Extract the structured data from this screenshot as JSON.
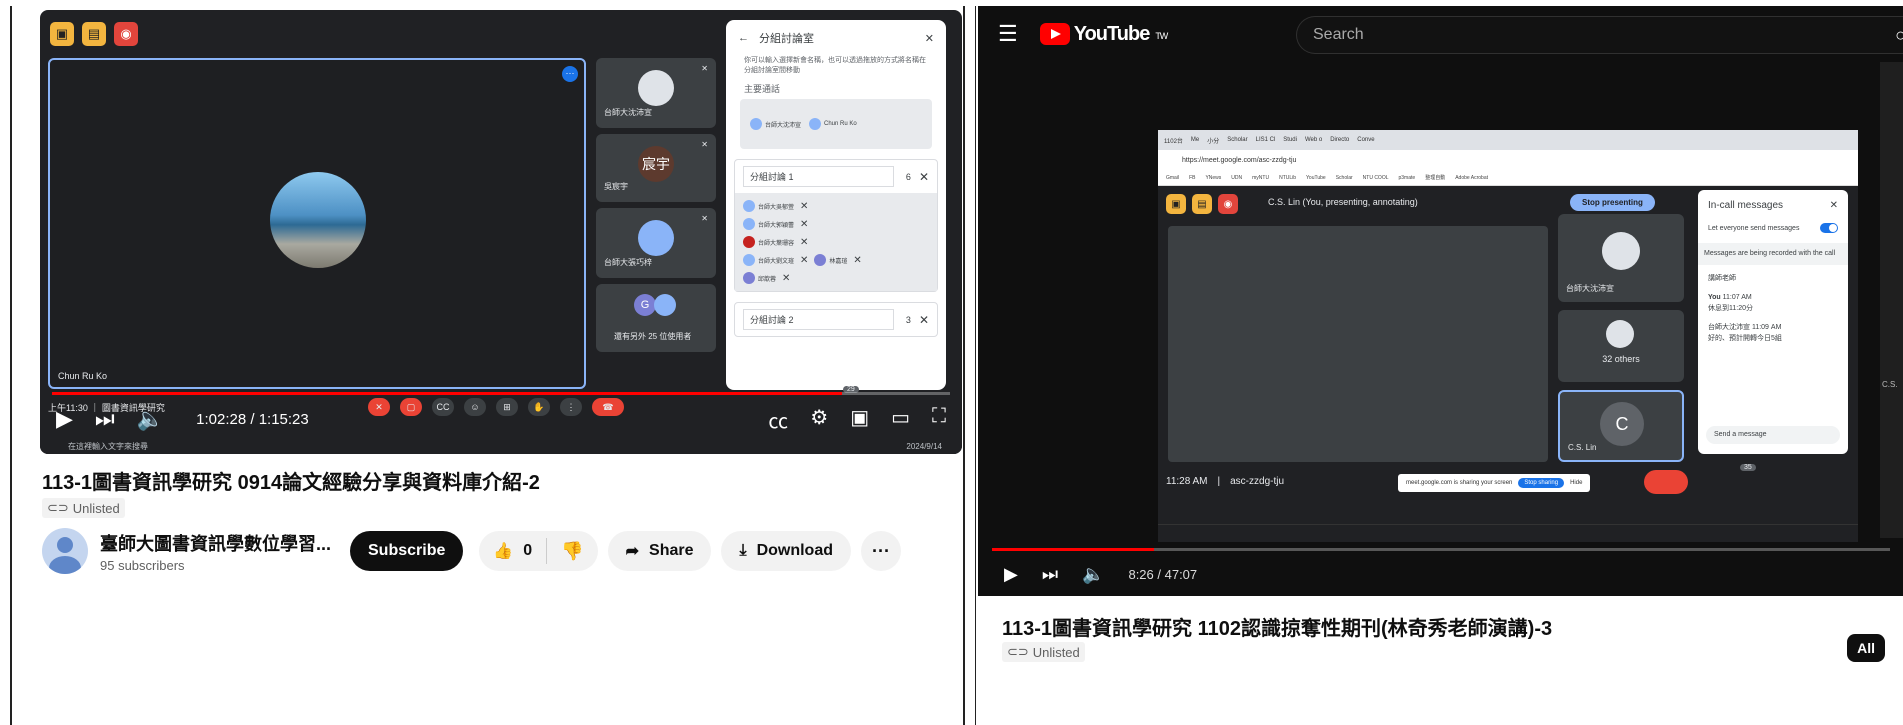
{
  "left": {
    "meet": {
      "main_tile_name": "Chun Ru Ko",
      "tiles": [
        {
          "name": "台師大沈沛宣",
          "avatar_text": ""
        },
        {
          "name": "吳宸宇",
          "avatar_text": "宸宇"
        },
        {
          "name": "台師大張巧梓",
          "avatar_text": ""
        },
        {
          "name": "還有另外 25 位使用者",
          "avatar_text": "G"
        }
      ],
      "breakout": {
        "title": "分組討論室",
        "desc": "你可以輸入選擇新會名稱，也可以透過拖放的方式將名稱在分組討論室間移動",
        "main_section": "主要通話",
        "main_members": [
          "台師大沈沛宣",
          "Chun Ru Ko"
        ],
        "groups": [
          {
            "name": "分組討論 1",
            "count": "6",
            "members": [
              "台師大吳郁萱",
              "台師大郭穎蕾",
              "台師大葉珊容",
              "台師大劉文瑄",
              "林嘉瑄",
              "邱歆蓉"
            ]
          },
          {
            "name": "分組討論 2",
            "count": "3",
            "members": []
          }
        ]
      },
      "bar_time": "上午11:30 ｜ 圖書資訊學研究",
      "participants_badge": "29",
      "taskbar_search": "在這裡輸入文字來搜尋",
      "taskbar_date": "2024/9/14"
    },
    "player": {
      "time": "1:02:28 / 1:15:23",
      "progress": 0.88
    },
    "video_title": "113-1圖書資訊學研究 0914論文經驗分享與資料庫介紹-2",
    "badge": "Unlisted",
    "channel_name": "臺師大圖書資訊學數位學習...",
    "subscribers": "95 subscribers",
    "subscribe": "Subscribe",
    "likes": "0",
    "share": "Share",
    "download": "Download",
    "more": "···"
  },
  "right": {
    "masthead": {
      "logo": "YouTube",
      "region": "TW",
      "search_placeholder": "Search"
    },
    "shared_screen": {
      "tabs": [
        "1102台",
        "Me",
        "小分",
        "Scholar",
        "LIS1 Cl",
        "Studi",
        "Web o",
        "Directo",
        "Conve"
      ],
      "url": "https://meet.google.com/asc-zzdg-tju",
      "bookmarks": [
        "Gmail",
        "FB",
        "YNews",
        "UDN",
        "myNTU",
        "NTULib",
        "YouTube",
        "Scholar",
        "NTU COOL",
        "p3mate",
        "整理自動",
        "Adobe Acrobat"
      ],
      "presenting": "C.S. Lin (You, presenting, annotating)",
      "stop_presenting": "Stop presenting",
      "tiles": [
        {
          "name": "台師大沈沛宣",
          "center": ""
        },
        {
          "name": "",
          "center": "32 others"
        },
        {
          "name": "C.S. Lin",
          "center": "C"
        }
      ],
      "chat": {
        "title": "In-call messages",
        "toggle_label": "Let everyone send messages",
        "note": "Messages are being recorded with the call",
        "messages": [
          {
            "author": "講師老師",
            "time": "",
            "text": ""
          },
          {
            "author": "You",
            "time": "11:07 AM",
            "text": "休息到11:20分"
          },
          {
            "author": "台師大沈沛宣",
            "time": "11:09 AM",
            "text": "好的、預計開轉今日5組"
          }
        ],
        "send_placeholder": "Send a message"
      },
      "bar_time": "11:28 AM",
      "bar_code": "asc-zzdg-tju",
      "share_notice": "meet.google.com is sharing your screen",
      "stop_sharing": "Stop sharing",
      "hide": "Hide",
      "participants_badge": "35"
    },
    "player": {
      "time": "8:26 / 47:07",
      "progress": 0.18
    },
    "video_title": "113-1圖書資訊學研究 1102認識掠奪性期刊(林奇秀老師演講)-3",
    "badge": "Unlisted",
    "all_chip": "All",
    "side_label": "C.S."
  }
}
